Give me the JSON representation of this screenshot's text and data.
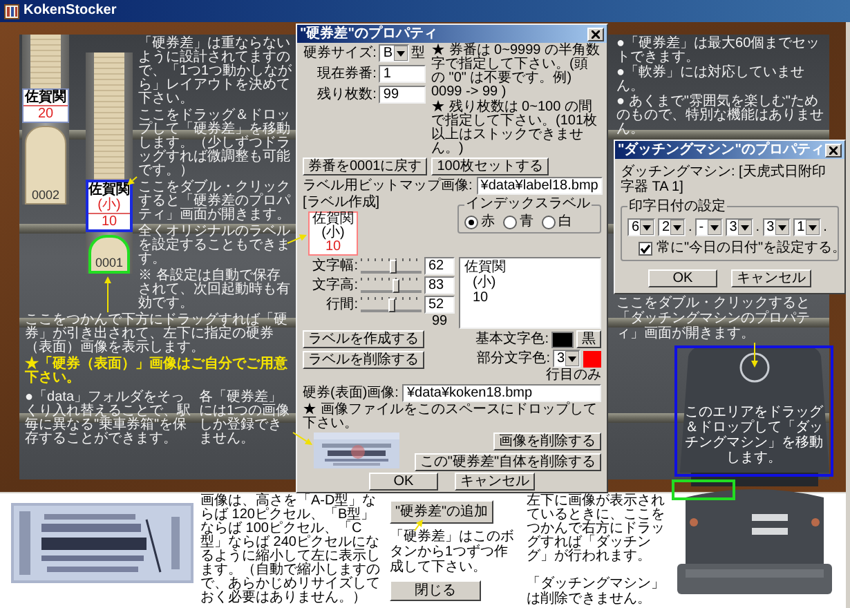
{
  "window": {
    "title": "KokenStocker"
  },
  "holders": [
    {
      "label": [
        "佐賀関",
        "20"
      ],
      "number": "0002",
      "selected": false
    },
    {
      "label": [
        "佐賀関",
        "(小)",
        "10"
      ],
      "number": "0001",
      "selected": true
    }
  ],
  "board_notes": [
    {
      "text": "「硬券差」は重ならないように設計されてますので、「1つ1つ動かしながら」レイアウトを決めて下さい。",
      "kind": "plain"
    },
    {
      "text": "ここをドラッグ＆ドロップして「硬券差」を移動します。（少しずつドラッグすれば微調整も可能です。）",
      "kind": "plain"
    },
    {
      "text": "ここをダブル・クリックすると「硬券差のプロパティ」画面が開きます。",
      "kind": "plain"
    },
    {
      "text": "全くオリジナルのラベルを設定することもできます。",
      "kind": "plain"
    },
    {
      "text": "※ 各設定は自動で保存されて、次回起動時も有効です。",
      "kind": "plain"
    },
    {
      "text": "ここをつかんで下方にドラッグすれば「硬券」が引き出されて、左下に指定の硬券（表面）画像を表示します。",
      "kind": "plain"
    },
    {
      "text": "★「硬券（表面）」画像はご自分でご用意下さい。",
      "kind": "highlight"
    },
    {
      "text": "●「data」フォルダをそっくり入れ替えることで、駅毎に異なる\"乗車券箱\"を保存することができます。",
      "kind": "plain"
    },
    {
      "text": "各「硬券差」には1つの画像しか登録できません。",
      "kind": "plain"
    }
  ],
  "info_notes": [
    "●「硬券差」は最大60個までセットできます。",
    "●「軟券」には対応していません。",
    "● あくまで\"雰囲気を楽しむ\"ためのもので、特別な機能はありません。"
  ],
  "property_dialog": {
    "title": "\"硬券差\"のプロパティ",
    "fields": [
      {
        "label": "硬券サイズ:",
        "value": "B",
        "kind": "combo",
        "suffix": "型"
      },
      {
        "label": "現在券番:",
        "value": "1",
        "kind": "text"
      },
      {
        "label": "残り枚数:",
        "value": "99",
        "kind": "text"
      }
    ],
    "notes": [
      "★ 券番は 0~9999 の半角数字で指定して下さい。(頭の \"0\" は不要です。例) 0099 -> 99 )",
      "★ 残り枚数は 0~100 の間で指定して下さい。(101枚以上はストックできません。)"
    ],
    "number_buttons": [
      "券番を0001に戻す",
      "100枚セットする"
    ],
    "bitmap": {
      "label": "ラベル用ビットマップ画像:",
      "value": "¥data¥label18.bmp"
    },
    "label_section": "[ラベル作成]",
    "label_preview": [
      "佐賀関",
      "(小)",
      "10"
    ],
    "index_label": {
      "title": "インデックスラベル",
      "options": [
        {
          "label": "赤",
          "selected": true
        },
        {
          "label": "青",
          "selected": false
        },
        {
          "label": "白",
          "selected": false
        }
      ]
    },
    "sliders": [
      {
        "label": "文字幅:",
        "level": 0.55,
        "value": "62"
      },
      {
        "label": "文字高:",
        "level": 0.6,
        "value": "83"
      },
      {
        "label": "行間:",
        "level": 0.5,
        "value": "52"
      }
    ],
    "slider_footnote": "99",
    "label_text": [
      "佐賀関",
      "(小)",
      "10"
    ],
    "label_buttons": [
      "ラベルを作成する",
      "ラベルを削除する"
    ],
    "base_color": {
      "label": "基本文字色:",
      "color": "#000000",
      "button": "黒"
    },
    "part_color": {
      "label": "部分文字色:",
      "line": "3",
      "color": "#ff0000",
      "suffix": "行目のみ"
    },
    "image": {
      "label": "硬券(表面)画像:",
      "value": "¥data¥koken18.bmp",
      "button": "画像を削除する",
      "drop_hint": "★ 画像ファイルをこのスペースにドロップして下さい。"
    },
    "delete_button": "この\"硬券差\"自体を削除する",
    "buttons": [
      "OK",
      "キャンセル"
    ]
  },
  "dating_dialog": {
    "title": "\"ダッチングマシン\"のプロパティ",
    "machine_label": "ダッチングマシン: [天虎式日附印字器 TA 1]",
    "group_title": "印字日付の設定",
    "date_parts": [
      {
        "value": "6"
      },
      {
        "value": "2",
        "sep": "."
      },
      {
        "value": "-"
      },
      {
        "value": "3",
        "sep": "."
      },
      {
        "value": "3"
      },
      {
        "value": "1",
        "sep": "."
      }
    ],
    "always_today": {
      "label": "常に\"今日の日付\"を設定する。",
      "checked": true
    },
    "buttons": [
      "OK",
      "キャンセル"
    ]
  },
  "machine": {
    "kind": "picture",
    "open_hint": "ここをダブル・クリックすると「ダッチングマシンのプロパティ」画面が開きます。",
    "drag_hint": "このエリアをドラッグ＆ドロップして「ダッチングマシン」を移動します。",
    "selected": true
  },
  "bottom": {
    "image_note": "画像は、高さを「A-D型」ならば 120ピクセル、「B型」ならば 100ピクセル、「C型」ならば 240ピクセルになるように縮小して左に表示します。（自動で縮小しますので、あらかじめリサイズしておく必要はありません。）",
    "add_button": "\"硬券差\"の追加",
    "add_note": "「硬券差」はこのボタンから1つずつ作成して下さい。",
    "close_button": "閉じる",
    "dating_note": "左下に画像が表示されているときに、ここをつかんで右方にドラッグすれば「ダッチング」が行われます。",
    "machine_note": "「ダッチングマシン」は削除できません。"
  }
}
